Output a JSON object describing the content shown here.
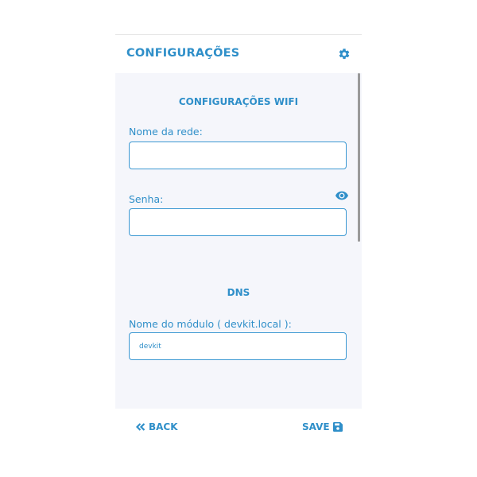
{
  "header": {
    "title": "CONFIGURAÇÕES",
    "settings_icon": "gear-icon"
  },
  "wifi": {
    "section_title": "CONFIGURAÇÕES WIFI",
    "network_name_label": "Nome da rede:",
    "network_name_value": "",
    "password_label": "Senha:",
    "password_value": "",
    "show_password_icon": "eye-icon"
  },
  "dns": {
    "section_title": "DNS",
    "module_name_label": "Nome do módulo ( devkit.local ):",
    "module_name_value": "devkit"
  },
  "footer": {
    "back_label": "BACK",
    "back_icon": "double-chevron-left-icon",
    "save_label": "SAVE",
    "save_icon": "floppy-disk-icon"
  },
  "colors": {
    "accent": "#2f8fc9",
    "content_background": "#f5f6fb",
    "input_border": "#3b98d2"
  }
}
